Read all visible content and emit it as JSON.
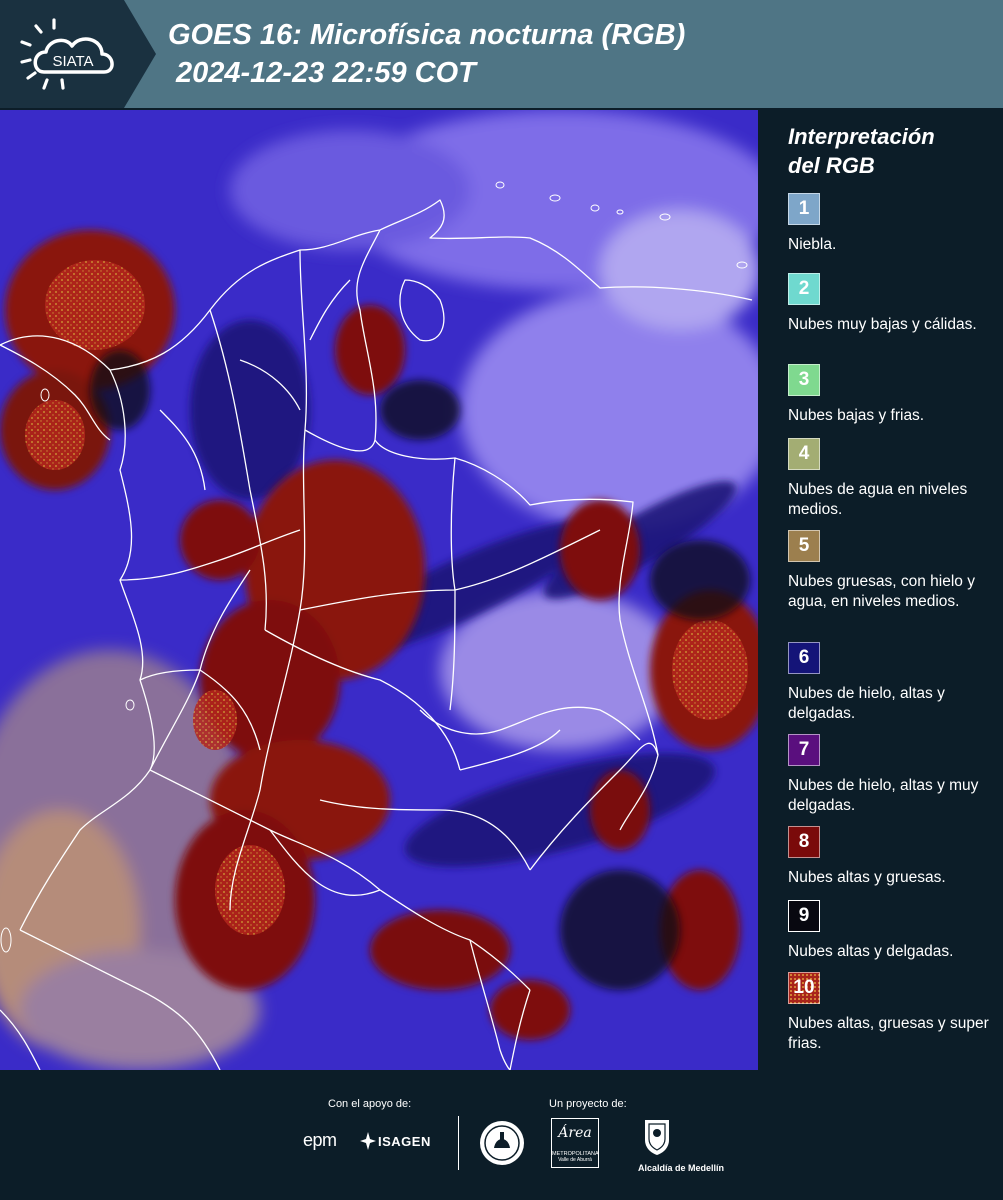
{
  "header": {
    "logo_text": "SIATA",
    "title_line1": "GOES 16: Microfísica nocturna (RGB)",
    "title_line2": "2024-12-23 22:59 COT"
  },
  "legend": {
    "title_line1": "Interpretación",
    "title_line2": "del RGB",
    "items": [
      {
        "num": "1",
        "label": "Niebla.",
        "color": "#7ea6c9"
      },
      {
        "num": "2",
        "label": "Nubes muy bajas y cálidas.",
        "color": "#6fd9cf"
      },
      {
        "num": "3",
        "label": "Nubes bajas y frias.",
        "color": "#7fd98f"
      },
      {
        "num": "4",
        "label": "Nubes de agua en niveles medios.",
        "color": "#a3ad73"
      },
      {
        "num": "5",
        "label": "Nubes gruesas, con hielo y agua, en niveles medios.",
        "color": "#9c7f4e"
      },
      {
        "num": "6",
        "label": "Nubes de hielo, altas y delgadas.",
        "color": "#141478"
      },
      {
        "num": "7",
        "label": "Nubes de hielo, altas y muy delgadas.",
        "color": "#5a0f7e"
      },
      {
        "num": "8",
        "label": "Nubes altas y gruesas.",
        "color": "#7a0a0a"
      },
      {
        "num": "9",
        "label": "Nubes altas y delgadas.",
        "color": "#080810"
      },
      {
        "num": "10",
        "label": "Nubes altas, gruesas y super frias.",
        "color": "#a8241a"
      }
    ]
  },
  "footer": {
    "support_label": "Con el apoyo de:",
    "project_label": "Un proyecto de:",
    "sponsor_epm": "epm",
    "sponsor_isagen": "ISAGEN",
    "partner_area_line1": "Área",
    "partner_area_line2": "METROPOLITANA",
    "partner_area_line3": "Valle de Aburrá",
    "partner_medellin": "Alcaldía de Medellín"
  }
}
